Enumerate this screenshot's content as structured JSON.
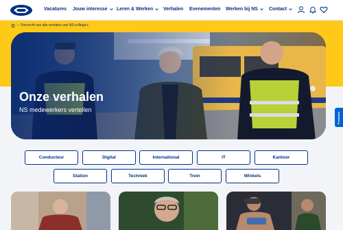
{
  "nav": {
    "items": [
      {
        "label": "Vacatures",
        "has_dropdown": false
      },
      {
        "label": "Jouw interesse",
        "has_dropdown": true
      },
      {
        "label": "Leren & Werken",
        "has_dropdown": true
      },
      {
        "label": "Verhalen",
        "has_dropdown": false
      },
      {
        "label": "Evenementen",
        "has_dropdown": false
      },
      {
        "label": "Werken bij NS",
        "has_dropdown": true
      },
      {
        "label": "Contact",
        "has_dropdown": true
      }
    ],
    "icons": [
      "user-icon",
      "bell-icon",
      "heart-icon"
    ]
  },
  "breadcrumb": {
    "home_icon": "home-icon",
    "current": "Overzicht van alle verhalen van NS-collega's"
  },
  "hero": {
    "title": "Onze verhalen",
    "subtitle": "NS medewerkers vertellen"
  },
  "feedback": {
    "label": "Feedback"
  },
  "categories": {
    "row1": [
      "Conducteur",
      "Digital",
      "International",
      "IT",
      "Kantoor"
    ],
    "row2": [
      "Station",
      "Techniek",
      "Trein",
      "Winkels"
    ]
  },
  "colors": {
    "ns_blue": "#003082",
    "ns_yellow": "#ffc917",
    "feedback_blue": "#0063d3",
    "background": "#f2f4f8"
  }
}
